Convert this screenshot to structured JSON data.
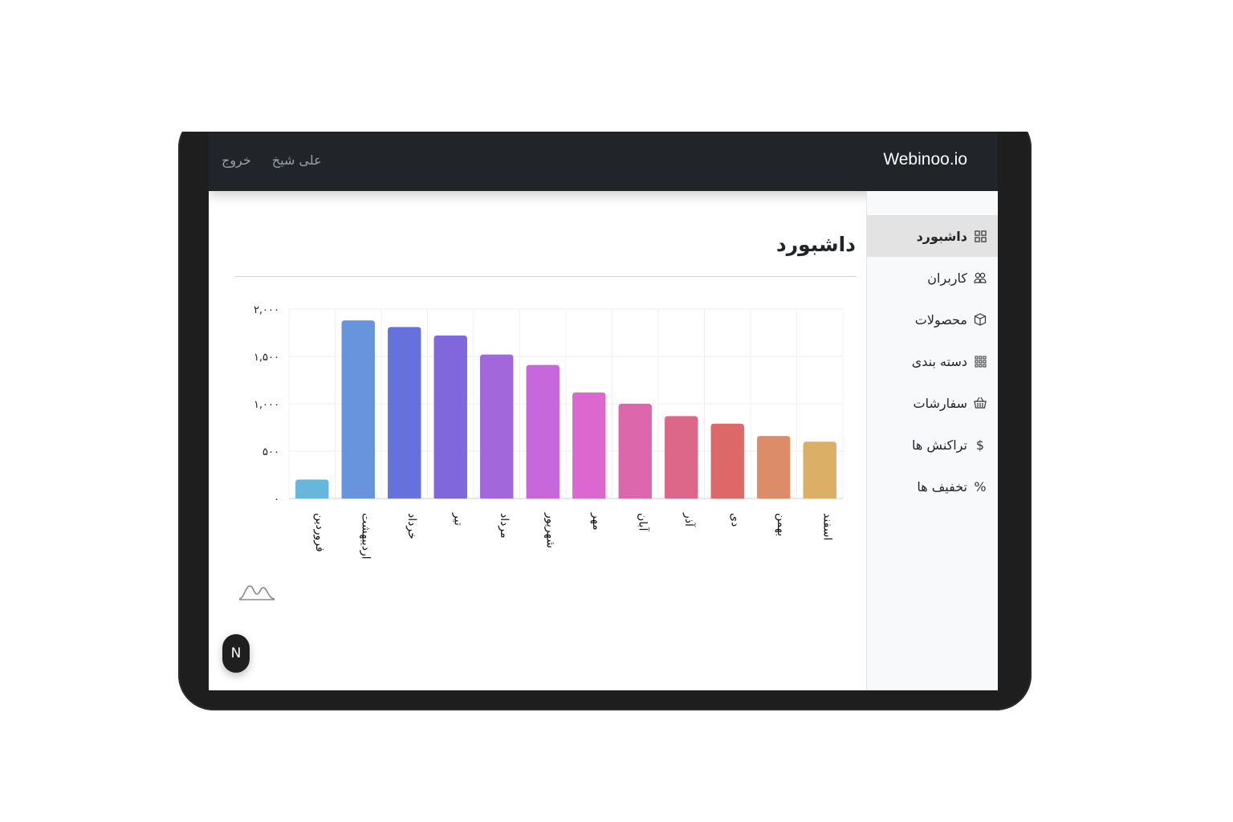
{
  "navbar": {
    "brand": "Webinoo.io",
    "user_name": "علی شیخ",
    "logout": "خروج"
  },
  "sidebar": {
    "items": [
      {
        "label": "داشبورد",
        "icon": "grid-icon",
        "active": true
      },
      {
        "label": "کاربران",
        "icon": "users-icon",
        "active": false
      },
      {
        "label": "محصولات",
        "icon": "box-icon",
        "active": false
      },
      {
        "label": "دسته بندی",
        "icon": "apps-icon",
        "active": false
      },
      {
        "label": "سفارشات",
        "icon": "basket-icon",
        "active": false
      },
      {
        "label": "تراکنش ها",
        "icon": "dollar-icon",
        "active": false
      },
      {
        "label": "تخفیف ها",
        "icon": "percent-icon",
        "active": false
      }
    ]
  },
  "main": {
    "title": "داشبورد",
    "fab_label": "N"
  },
  "colors": {
    "navbar": "#212529",
    "sidebar_bg": "#f8f9fa",
    "active_item": "#e3e3e3"
  },
  "chart_data": {
    "type": "bar",
    "categories": [
      "فروردین",
      "اردیبهشت",
      "خرداد",
      "تیر",
      "مرداد",
      "شهریور",
      "مهر",
      "آبان",
      "آذر",
      "دی",
      "بهمن",
      "اسفند"
    ],
    "values": [
      200,
      1880,
      1810,
      1720,
      1520,
      1410,
      1120,
      1000,
      870,
      790,
      660,
      600
    ],
    "colors": [
      "#67b7dc",
      "#6794dc",
      "#6771dc",
      "#8067dc",
      "#a367dc",
      "#c767dc",
      "#dc67ce",
      "#dc67ab",
      "#dc6788",
      "#dc6967",
      "#dc8c67",
      "#dcaf67"
    ],
    "yticks": [
      "۰",
      "۵۰۰",
      "۱,۰۰۰",
      "۱,۵۰۰",
      "۲,۰۰۰"
    ],
    "ytick_values": [
      0,
      500,
      1000,
      1500,
      2000
    ],
    "ylim": [
      0,
      2000
    ],
    "grid": true
  }
}
